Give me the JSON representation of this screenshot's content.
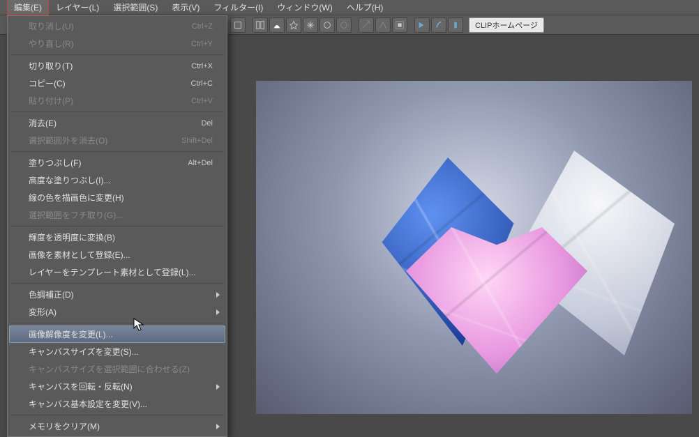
{
  "menubar": {
    "items": [
      {
        "label": "編集(E)",
        "active": true
      },
      {
        "label": "レイヤー(L)"
      },
      {
        "label": "選択範囲(S)"
      },
      {
        "label": "表示(V)"
      },
      {
        "label": "フィルター(I)"
      },
      {
        "label": "ウィンドウ(W)"
      },
      {
        "label": "ヘルプ(H)"
      }
    ]
  },
  "toolbar": {
    "clip_label": "CLIPホームページ"
  },
  "dropdown": {
    "groups": [
      [
        {
          "label": "取り消し(U)",
          "shortcut": "Ctrl+Z",
          "disabled": true
        },
        {
          "label": "やり直し(R)",
          "shortcut": "Ctrl+Y",
          "disabled": true
        }
      ],
      [
        {
          "label": "切り取り(T)",
          "shortcut": "Ctrl+X"
        },
        {
          "label": "コピー(C)",
          "shortcut": "Ctrl+C"
        },
        {
          "label": "貼り付け(P)",
          "shortcut": "Ctrl+V",
          "disabled": true
        }
      ],
      [
        {
          "label": "消去(E)",
          "shortcut": "Del"
        },
        {
          "label": "選択範囲外を消去(O)",
          "shortcut": "Shift+Del",
          "disabled": true
        }
      ],
      [
        {
          "label": "塗りつぶし(F)",
          "shortcut": "Alt+Del"
        },
        {
          "label": "高度な塗りつぶし(I)..."
        },
        {
          "label": "線の色を描画色に変更(H)"
        },
        {
          "label": "選択範囲をフチ取り(G)...",
          "disabled": true
        }
      ],
      [
        {
          "label": "輝度を透明度に変換(B)"
        },
        {
          "label": "画像を素材として登録(E)..."
        },
        {
          "label": "レイヤーをテンプレート素材として登録(L)..."
        }
      ],
      [
        {
          "label": "色調補正(D)",
          "submenu": true
        },
        {
          "label": "変形(A)",
          "submenu": true
        }
      ],
      [
        {
          "label": "画像解像度を変更(L)...",
          "hover": true
        },
        {
          "label": "キャンバスサイズを変更(S)..."
        },
        {
          "label": "キャンバスサイズを選択範囲に合わせる(Z)",
          "disabled": true
        },
        {
          "label": "キャンバスを回転・反転(N)",
          "submenu": true
        },
        {
          "label": "キャンバス基本設定を変更(V)..."
        }
      ],
      [
        {
          "label": "メモリをクリア(M)",
          "submenu": true
        }
      ]
    ]
  }
}
